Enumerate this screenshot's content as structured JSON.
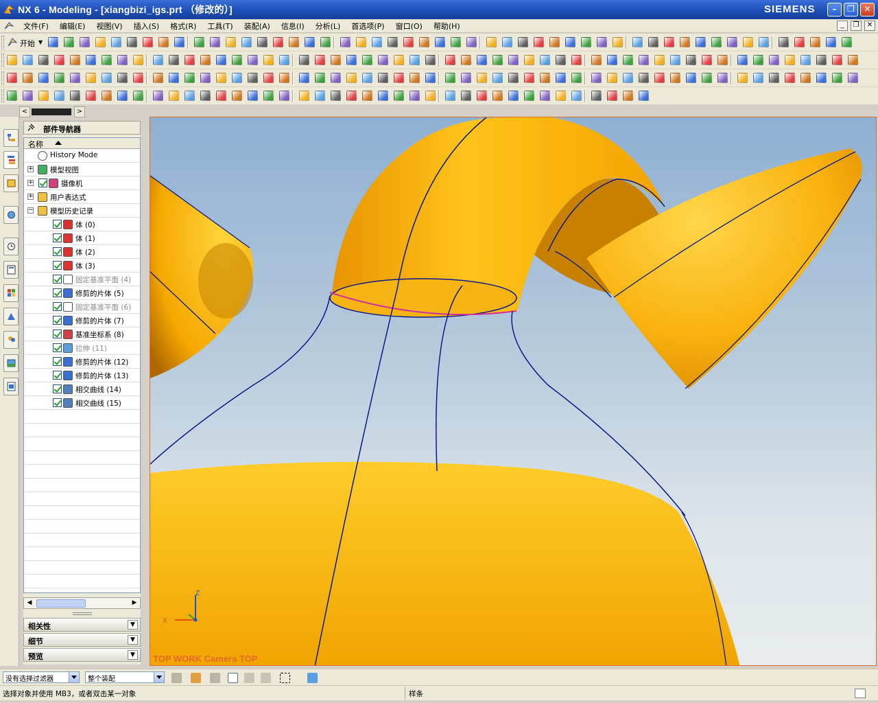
{
  "window": {
    "title": "NX 6 - Modeling - [xiangbizi_igs.prt （修改的）]",
    "brand": "SIEMENS",
    "minimize": "–",
    "maximize": "❐",
    "close": "✕"
  },
  "menubar": {
    "items": [
      "文件(F)",
      "编辑(E)",
      "视图(V)",
      "插入(S)",
      "格式(R)",
      "工具(T)",
      "装配(A)",
      "信息(I)",
      "分析(L)",
      "首选项(P)",
      "窗口(O)",
      "帮助(H)"
    ]
  },
  "toolbar": {
    "start_label": "开始"
  },
  "navigator": {
    "title": "部件导航器",
    "column_name": "名称",
    "rows": [
      {
        "name": "History Mode",
        "level": 0,
        "expand": "",
        "check": false,
        "dim": false,
        "icon": "clock-icon"
      },
      {
        "name": "模型视图",
        "level": 0,
        "expand": "+",
        "check": false,
        "dim": false,
        "icon": "model-view-icon"
      },
      {
        "name": "摄像机",
        "level": 0,
        "expand": "+",
        "check": true,
        "dim": false,
        "icon": "camera-icon"
      },
      {
        "name": "用户表达式",
        "level": 0,
        "expand": "+",
        "check": false,
        "dim": false,
        "icon": "folder-icon"
      },
      {
        "name": "模型历史记录",
        "level": 0,
        "expand": "−",
        "check": false,
        "dim": false,
        "icon": "folder-icon"
      },
      {
        "name": "体 (0)",
        "level": 1,
        "check": true,
        "dim": false,
        "icon": "body-icon"
      },
      {
        "name": "体 (1)",
        "level": 1,
        "check": true,
        "dim": false,
        "icon": "body-icon"
      },
      {
        "name": "体 (2)",
        "level": 1,
        "check": true,
        "dim": false,
        "icon": "body-icon"
      },
      {
        "name": "体 (3)",
        "level": 1,
        "check": true,
        "dim": false,
        "icon": "body-icon"
      },
      {
        "name": "固定基准平面 (4)",
        "level": 1,
        "check": true,
        "dim": true,
        "icon": "datum-plane-icon"
      },
      {
        "name": "修剪的片体 (5)",
        "level": 1,
        "check": true,
        "dim": false,
        "icon": "trimmed-sheet-icon"
      },
      {
        "name": "固定基准平面 (6)",
        "level": 1,
        "check": true,
        "dim": true,
        "icon": "datum-plane-icon"
      },
      {
        "name": "修剪的片体 (7)",
        "level": 1,
        "check": true,
        "dim": false,
        "icon": "trimmed-sheet-icon"
      },
      {
        "name": "基准坐标系 (8)",
        "level": 1,
        "check": true,
        "dim": false,
        "icon": "datum-csys-icon"
      },
      {
        "name": "拉伸 (11)",
        "level": 1,
        "check": true,
        "dim": true,
        "icon": "extrude-icon"
      },
      {
        "name": "修剪的片体 (12)",
        "level": 1,
        "check": true,
        "dim": false,
        "icon": "trimmed-sheet-icon"
      },
      {
        "name": "修剪的片体 (13)",
        "level": 1,
        "check": true,
        "dim": false,
        "icon": "trimmed-sheet-icon"
      },
      {
        "name": "相交曲线 (14)",
        "level": 1,
        "check": true,
        "dim": false,
        "icon": "intersection-curve-icon"
      },
      {
        "name": "相交曲线 (15)",
        "level": 1,
        "check": true,
        "dim": false,
        "icon": "intersection-curve-icon"
      }
    ],
    "panels": [
      "相关性",
      "细节",
      "预览"
    ]
  },
  "viewport": {
    "view_label": "TOP WORK Camera TOP",
    "axis_x": "X",
    "axis_z": "Z",
    "accent": "#e46b2a"
  },
  "selection_bar": {
    "filter": "没有选择过滤器",
    "scope": "整个装配"
  },
  "statusbar": {
    "prompt": "选择对象并使用 MB3，或者双击某一对象",
    "status": "样条"
  }
}
